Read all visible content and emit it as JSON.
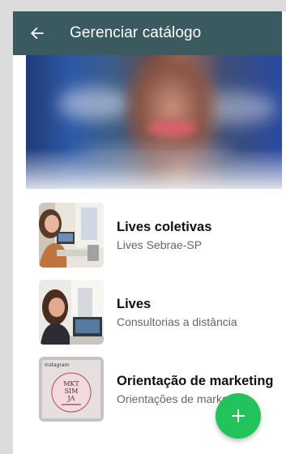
{
  "appbar": {
    "title": "Gerenciar catálogo"
  },
  "items": [
    {
      "name": "Lives coletivas",
      "subtitle": "Lives Sebrae-SP"
    },
    {
      "name": "Lives",
      "subtitle": "Consultorias a distância"
    },
    {
      "name": "Orientação de marketing",
      "subtitle": "Orientações de marketing"
    }
  ],
  "thumb3_text": {
    "brand": "Instagram",
    "l1": "MKT",
    "l2": "SIM",
    "l3": "JA"
  },
  "colors": {
    "appbar": "#3a5a5f",
    "fab": "#21c35a"
  },
  "icons": {
    "back": "arrow-left",
    "fab": "plus"
  }
}
